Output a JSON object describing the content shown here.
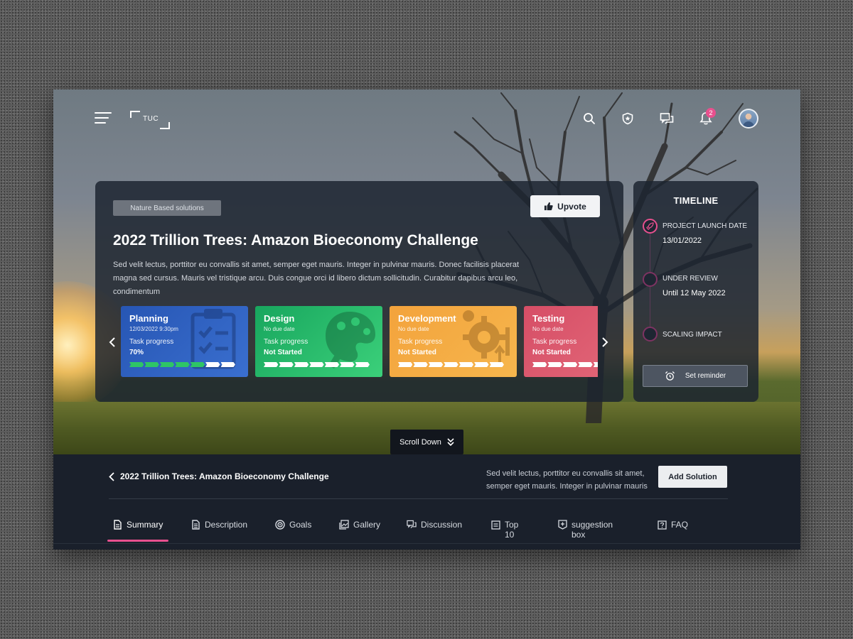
{
  "header": {
    "logo_text": "TUC",
    "notification_count": "2"
  },
  "challenge": {
    "tag": "Nature Based solutions",
    "upvote_label": "Upvote",
    "title": "2022 Trillion Trees: Amazon Bioeconomy Challenge",
    "description": "Sed velit lectus, porttitor eu convallis sit amet, semper eget mauris. Integer in pulvinar mauris. Donec facilisis placerat magna sed cursus. Mauris vel tristique arcu. Duis congue orci id libero dictum sollicitudin. Curabitur dapibus arcu leo, condimentum"
  },
  "stages": [
    {
      "title": "Planning",
      "date": "12/03/2022  9:30pm",
      "progress_label": "Task progress",
      "status": "70%",
      "progress": 0.7
    },
    {
      "title": "Design",
      "date": "No due date",
      "progress_label": "Task progress",
      "status": "Not Started",
      "progress": 0
    },
    {
      "title": "Development",
      "date": "No due date",
      "progress_label": "Task progress",
      "status": "Not Started",
      "progress": 0
    },
    {
      "title": "Testing",
      "date": "No due date",
      "progress_label": "Task progress",
      "status": "Not Started",
      "progress": 0
    }
  ],
  "timeline": {
    "title": "TIMELINE",
    "items": [
      {
        "label": "PROJECT LAUNCH DATE",
        "value": "13/01/2022"
      },
      {
        "label": "UNDER REVIEW",
        "value": "Until 12 May 2022"
      },
      {
        "label": "SCALING IMPACT",
        "value": ""
      }
    ],
    "reminder_label": "Set reminder"
  },
  "scroll_label": "Scroll Down",
  "bottom": {
    "title": "2022 Trillion Trees: Amazon Bioeconomy Challenge",
    "description": "Sed velit lectus, porttitor eu convallis sit amet, semper eget mauris. Integer in pulvinar mauris",
    "add_solution_label": "Add Solution"
  },
  "tabs": [
    {
      "label": "Summary",
      "icon": "document-icon"
    },
    {
      "label": "Description",
      "icon": "file-text-icon"
    },
    {
      "label": "Goals",
      "icon": "target-icon"
    },
    {
      "label": "Gallery",
      "icon": "gallery-icon"
    },
    {
      "label": "Discussion",
      "icon": "chat-icon"
    },
    {
      "label": "Top 10",
      "icon": "list-icon"
    },
    {
      "label": "suggestion box",
      "icon": "plus-box-icon"
    },
    {
      "label": "FAQ",
      "icon": "question-icon"
    }
  ],
  "colors": {
    "accent": "#e8508e",
    "planning": "#2756b4",
    "design": "#18a65e",
    "development": "#f3a33c",
    "testing": "#d64e66",
    "progress_done": "#2ec566"
  }
}
